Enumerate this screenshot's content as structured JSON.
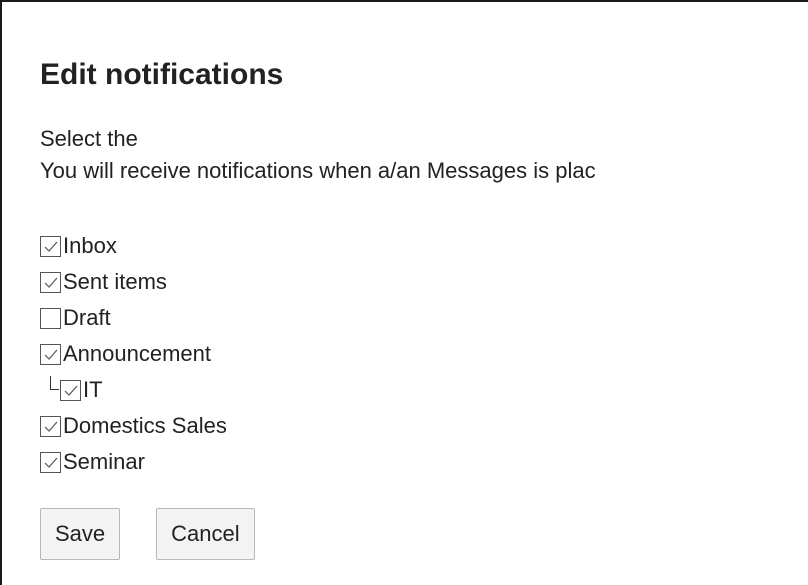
{
  "dialog": {
    "title": "Edit notifications",
    "description_line1": "Select the",
    "description_line2": "You will receive notifications when a/an Messages is plac"
  },
  "folders": [
    {
      "label": "Inbox",
      "checked": true
    },
    {
      "label": "Sent items",
      "checked": true
    },
    {
      "label": "Draft",
      "checked": false
    },
    {
      "label": "Announcement",
      "checked": true
    },
    {
      "label": "IT",
      "checked": true,
      "child_of": "Announcement"
    },
    {
      "label": "Domestics Sales",
      "checked": true
    },
    {
      "label": "Seminar",
      "checked": true
    }
  ],
  "buttons": {
    "save_label": "Save",
    "cancel_label": "Cancel"
  }
}
